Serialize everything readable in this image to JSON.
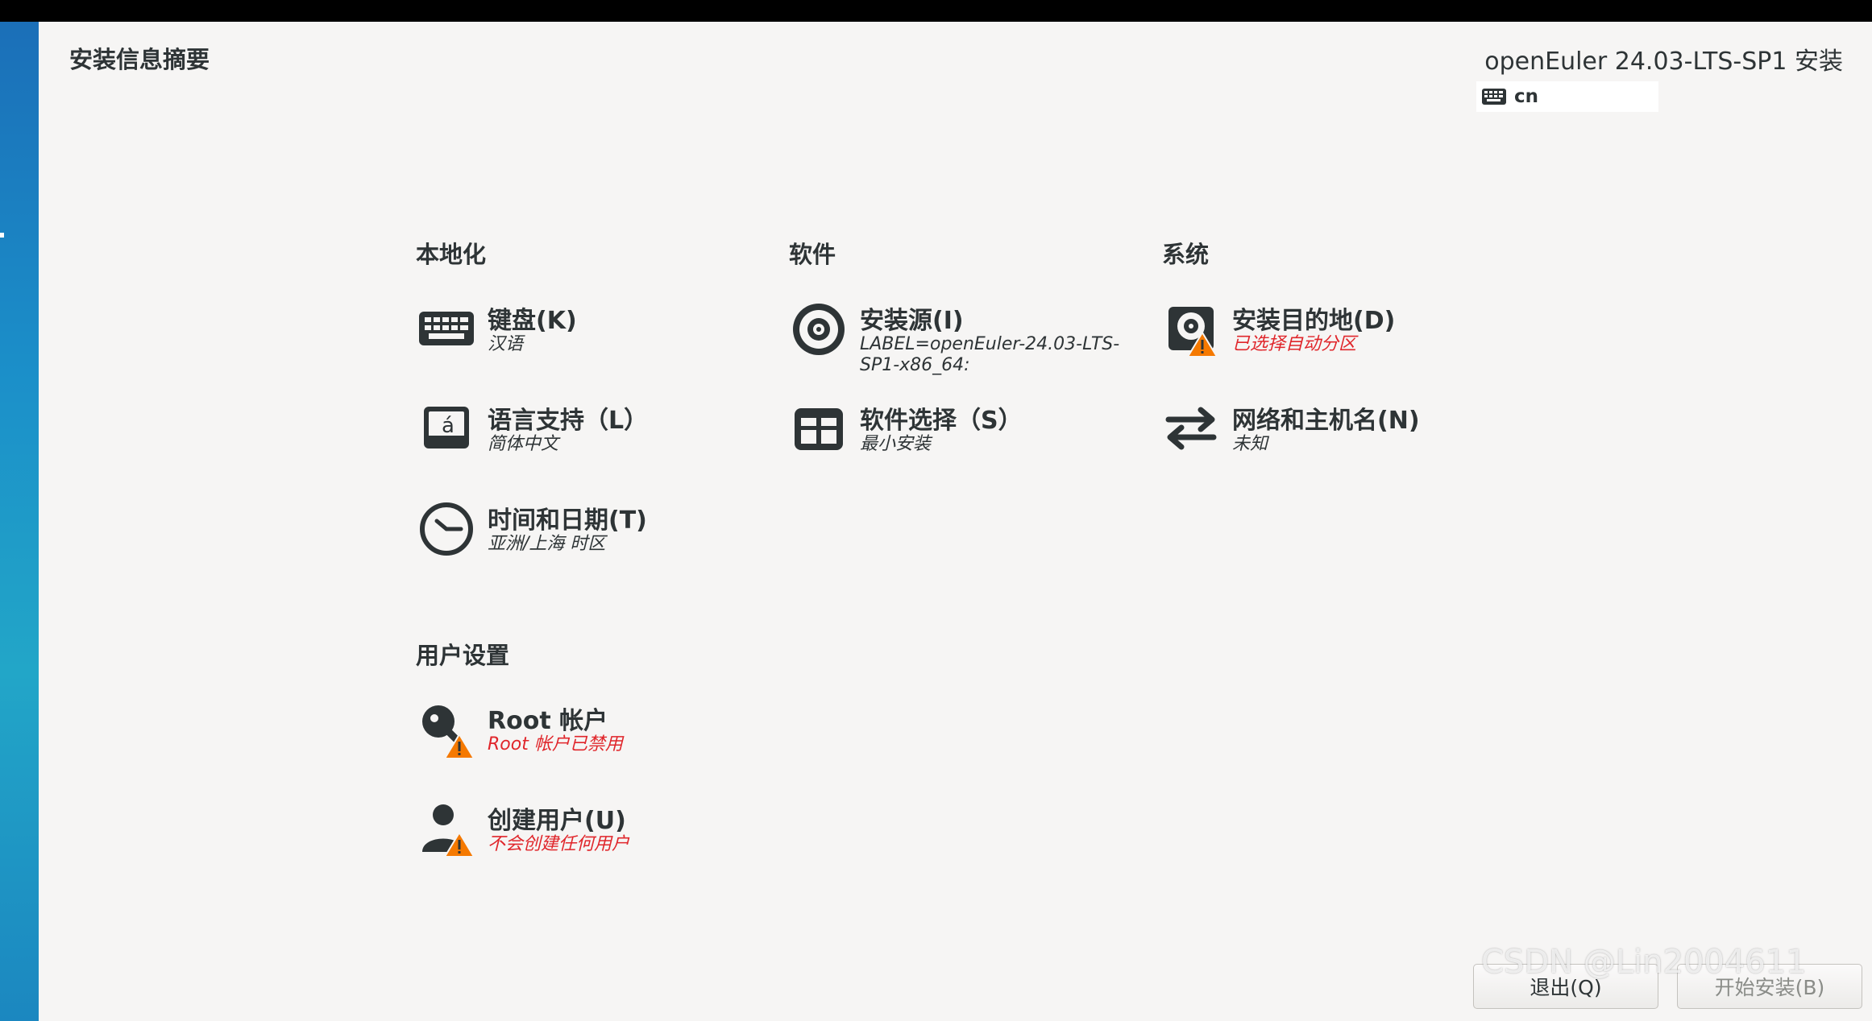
{
  "header": {
    "page_title": "安装信息摘要",
    "product_title": "openEuler 24.03-LTS-SP1 安装",
    "keyboard_layout": "cn"
  },
  "sections": {
    "localization": {
      "title": "本地化",
      "keyboard": {
        "title": "键盘(K)",
        "status": "汉语",
        "icon": "keyboard-icon"
      },
      "language": {
        "title": "语言支持（L）",
        "status": "简体中文",
        "icon": "language-icon"
      },
      "time": {
        "title": "时间和日期(T)",
        "status": "亚洲/上海 时区",
        "icon": "clock-icon"
      }
    },
    "software": {
      "title": "软件",
      "source": {
        "title": "安装源(I)",
        "status": "LABEL=openEuler-24.03-LTS-SP1-x86_64:",
        "icon": "disc-icon"
      },
      "selection": {
        "title": "软件选择（S）",
        "status": "最小安装",
        "icon": "package-icon"
      }
    },
    "system": {
      "title": "系统",
      "destination": {
        "title": "安装目的地(D)",
        "status": "已选择自动分区",
        "icon": "harddisk-warning-icon"
      },
      "network": {
        "title": "网络和主机名(N)",
        "status": "未知",
        "icon": "network-arrows-icon"
      }
    },
    "user": {
      "title": "用户设置",
      "root": {
        "title": "Root 帐户",
        "status": "Root 帐户已禁用",
        "icon": "root-key-warning-icon"
      },
      "create_user": {
        "title": "创建用户(U)",
        "status": "不会创建任何用户",
        "icon": "user-warning-icon"
      }
    }
  },
  "buttons": {
    "quit": "退出(Q)",
    "begin": "开始安装(B)"
  },
  "watermark": "CSDN @Lin2004611",
  "colors": {
    "background": "#f6f5f4",
    "text": "#2e3436",
    "warning_text": "#e0262b",
    "warning_badge": "#f57900",
    "sidebar": "#1b8fc9"
  }
}
